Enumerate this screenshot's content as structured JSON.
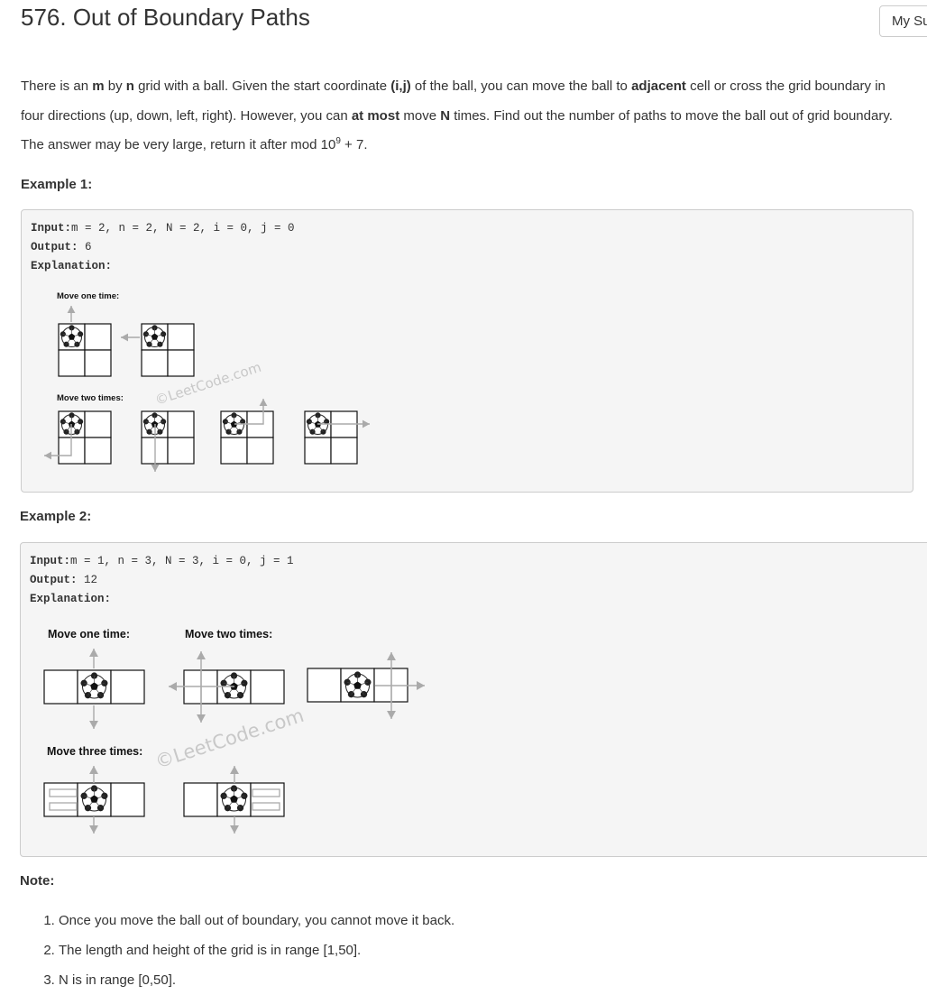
{
  "header": {
    "title": "576. Out of Boundary Paths",
    "my_submissions_label": "My Su"
  },
  "description": {
    "p1": "There is an ",
    "m": "m",
    "p2": " by ",
    "n": "n",
    "p3": " grid with a ball. Given the start coordinate ",
    "ij": "(i,j)",
    "p4": " of the ball, you can move the ball to ",
    "adjacent": "adjacent",
    "p5": " cell or cross the grid boundary in four directions (up, down, left, right). However, you can ",
    "at_most": "at most",
    "p6": " move ",
    "N": "N",
    "p7": " times. Find out the number of paths to move the ball out of grid boundary. The answer may be very large, return it after mod 10",
    "exp": "9",
    "p8": " + 7."
  },
  "example1": {
    "heading": "Example 1:",
    "input_label": "Input:",
    "input_value": "m = 2, n = 2, N = 2, i = 0, j = 0",
    "output_label": "Output:",
    "output_value": " 6",
    "explanation_label": "Explanation:",
    "figure": {
      "label_one": "Move one time:",
      "label_two": "Move two times:",
      "watermark": "©LeetCode.com"
    }
  },
  "example2": {
    "heading": "Example 2:",
    "input_label": "Input:",
    "input_value": "m = 1, n = 3, N = 3, i = 0, j = 1",
    "output_label": "Output:",
    "output_value": " 12",
    "explanation_label": "Explanation:",
    "figure": {
      "label_one": "Move one time:",
      "label_two": "Move two times:",
      "label_three": "Move three times:",
      "watermark": "©LeetCode.com"
    }
  },
  "note": {
    "heading": "Note:",
    "items": [
      "Once you move the ball out of boundary, you cannot move it back.",
      "The length and height of the grid is in range [1,50].",
      "N is in range [0,50]."
    ]
  },
  "colors": {
    "text": "#333333",
    "code_bg": "#f5f5f5",
    "border": "#cccccc",
    "arrow": "#aaaaaa"
  },
  "icons": [
    "soccer-ball-icon",
    "arrow-up-icon",
    "arrow-left-icon",
    "arrow-right-icon",
    "arrow-down-icon"
  ]
}
